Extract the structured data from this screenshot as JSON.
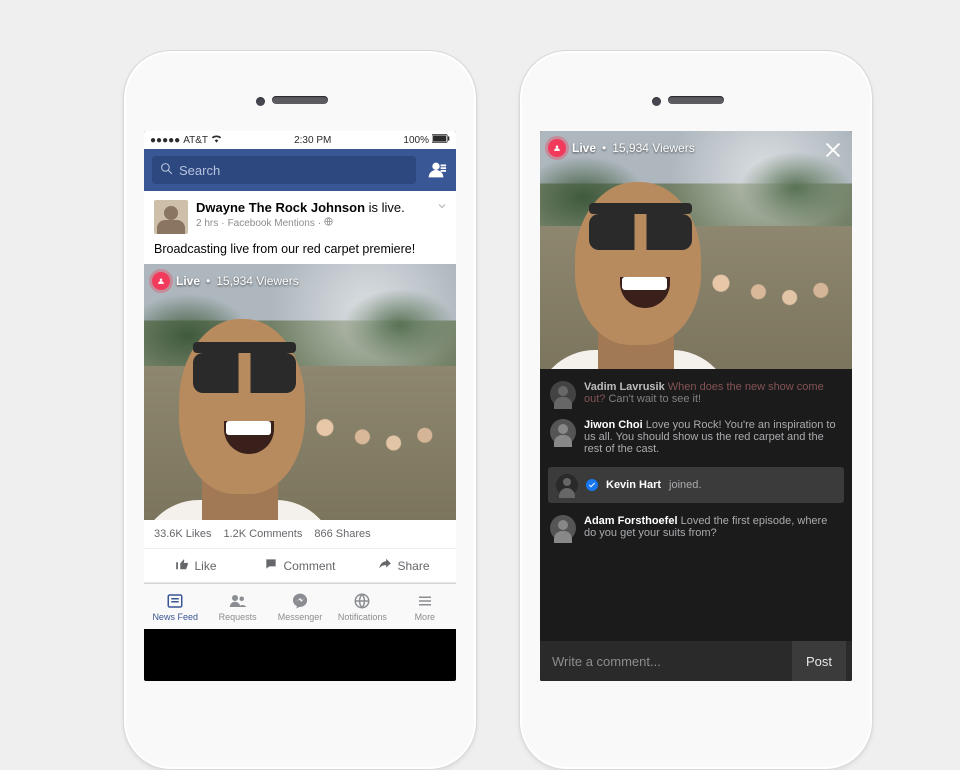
{
  "statusbar": {
    "carrier": "AT&T",
    "time": "2:30 PM",
    "battery": "100%"
  },
  "search": {
    "placeholder": "Search"
  },
  "post": {
    "author": "Dwayne The Rock Johnson",
    "verb": " is live.",
    "age": "2 hrs",
    "via": "Facebook Mentions",
    "body": "Broadcasting live from our red carpet premiere!"
  },
  "live": {
    "label": "Live",
    "viewers": "15,934 Viewers"
  },
  "stats": {
    "likes": "33.6K Likes",
    "comments": "1.2K Comments",
    "shares": "866 Shares"
  },
  "actions": {
    "like": "Like",
    "comment": "Comment",
    "share": "Share"
  },
  "tabs": {
    "feed": "News Feed",
    "requests": "Requests",
    "messenger": "Messenger",
    "notifications": "Notifications",
    "more": "More"
  },
  "fullscreen": {
    "comments": [
      {
        "name": "Vadim Lavrusik",
        "msg_accent": "When does the new show come out?",
        "msg": " Can't wait to see it!"
      },
      {
        "name": "Jiwon Choi",
        "msg": " Love you Rock! You're an inspiration to us all. You should show us the red carpet and the rest of the cast."
      },
      {
        "name": "Adam Forsthoefel",
        "msg": " Loved the first episode, where do you get your suits from?"
      }
    ],
    "joined": {
      "name": "Kevin Hart",
      "verb": " joined."
    },
    "composer": {
      "placeholder": "Write a comment...",
      "post": "Post"
    }
  }
}
